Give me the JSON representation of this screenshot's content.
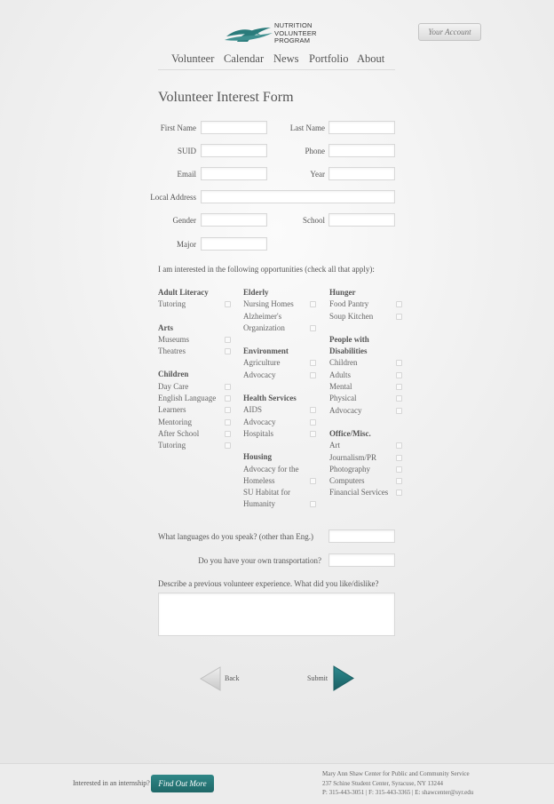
{
  "header": {
    "logo_lines": [
      "NUTRITION",
      "VOLUNTEER",
      "PROGRAM"
    ],
    "account_button": "Your Account",
    "nav": [
      "Volunteer",
      "Calendar",
      "News",
      "Portfolio",
      "About"
    ]
  },
  "form": {
    "title": "Volunteer Interest Form",
    "labels": {
      "first_name": "First Name",
      "last_name": "Last Name",
      "suid": "SUID",
      "phone": "Phone",
      "email": "Email",
      "year": "Year",
      "local_address": "Local Address",
      "gender": "Gender",
      "school": "School",
      "major": "Major"
    },
    "intro": "I am interested in the following opportunities (check all that apply):",
    "columns": [
      {
        "groups": [
          {
            "title": [
              "Adult Literacy"
            ],
            "items": [
              [
                "Tutoring"
              ]
            ]
          },
          {
            "title": [
              "Arts"
            ],
            "items": [
              [
                "Museums"
              ],
              [
                "Theatres"
              ]
            ]
          },
          {
            "title": [
              "Children"
            ],
            "items": [
              [
                "Day Care"
              ],
              [
                "English Language"
              ],
              [
                "Learners"
              ],
              [
                "Mentoring"
              ],
              [
                "After School"
              ],
              [
                "Tutoring"
              ]
            ]
          }
        ]
      },
      {
        "groups": [
          {
            "title": [
              "Elderly"
            ],
            "items": [
              [
                "Nursing Homes"
              ],
              [
                "Alzheimer's",
                "Organization"
              ]
            ]
          },
          {
            "title": [
              "Environment"
            ],
            "items": [
              [
                "Agriculture"
              ],
              [
                "Advocacy"
              ]
            ]
          },
          {
            "title": [
              "Health Services"
            ],
            "items": [
              [
                "AIDS"
              ],
              [
                "Advocacy"
              ],
              [
                "Hospitals"
              ]
            ]
          },
          {
            "title": [
              "Housing"
            ],
            "items": [
              [
                "Advocacy for the",
                "Homeless"
              ],
              [
                "SU Habitat for",
                "Humanity"
              ]
            ]
          }
        ]
      },
      {
        "groups": [
          {
            "title": [
              "Hunger"
            ],
            "items": [
              [
                "Food Pantry"
              ],
              [
                "Soup Kitchen"
              ]
            ]
          },
          {
            "title": [
              "People with",
              "Disabilities"
            ],
            "items": [
              [
                "Children"
              ],
              [
                "Adults"
              ],
              [
                "Mental"
              ],
              [
                "Physical"
              ],
              [
                "Advocacy"
              ]
            ]
          },
          {
            "title": [
              "Office/Misc."
            ],
            "items": [
              [
                "Art"
              ],
              [
                "Journalism/PR"
              ],
              [
                "Photography"
              ],
              [
                "Computers"
              ],
              [
                "Financial Services"
              ]
            ]
          }
        ]
      }
    ],
    "languages_q": "What languages do you speak? (other than Eng.)",
    "transport_q": "Do you have your own transportation?",
    "experience_q": "Describe a previous volunteer experience. What did you like/dislike?",
    "back_label": "Back",
    "submit_label": "Submit"
  },
  "footer": {
    "intern_q": "Interested in an internship?",
    "find_button": "Find Out More",
    "address_lines": [
      "Mary Ann Shaw Center for Public and Community Service",
      "237 Schine Student Center, Syracuse, NY 13244",
      "P: 315-443-3051  |  F: 315-443-3365  |  E: shawcenter@syr.edu"
    ]
  },
  "colors": {
    "brand_teal": "#2a7b7b",
    "arrow_teal": "#1f6e73"
  }
}
